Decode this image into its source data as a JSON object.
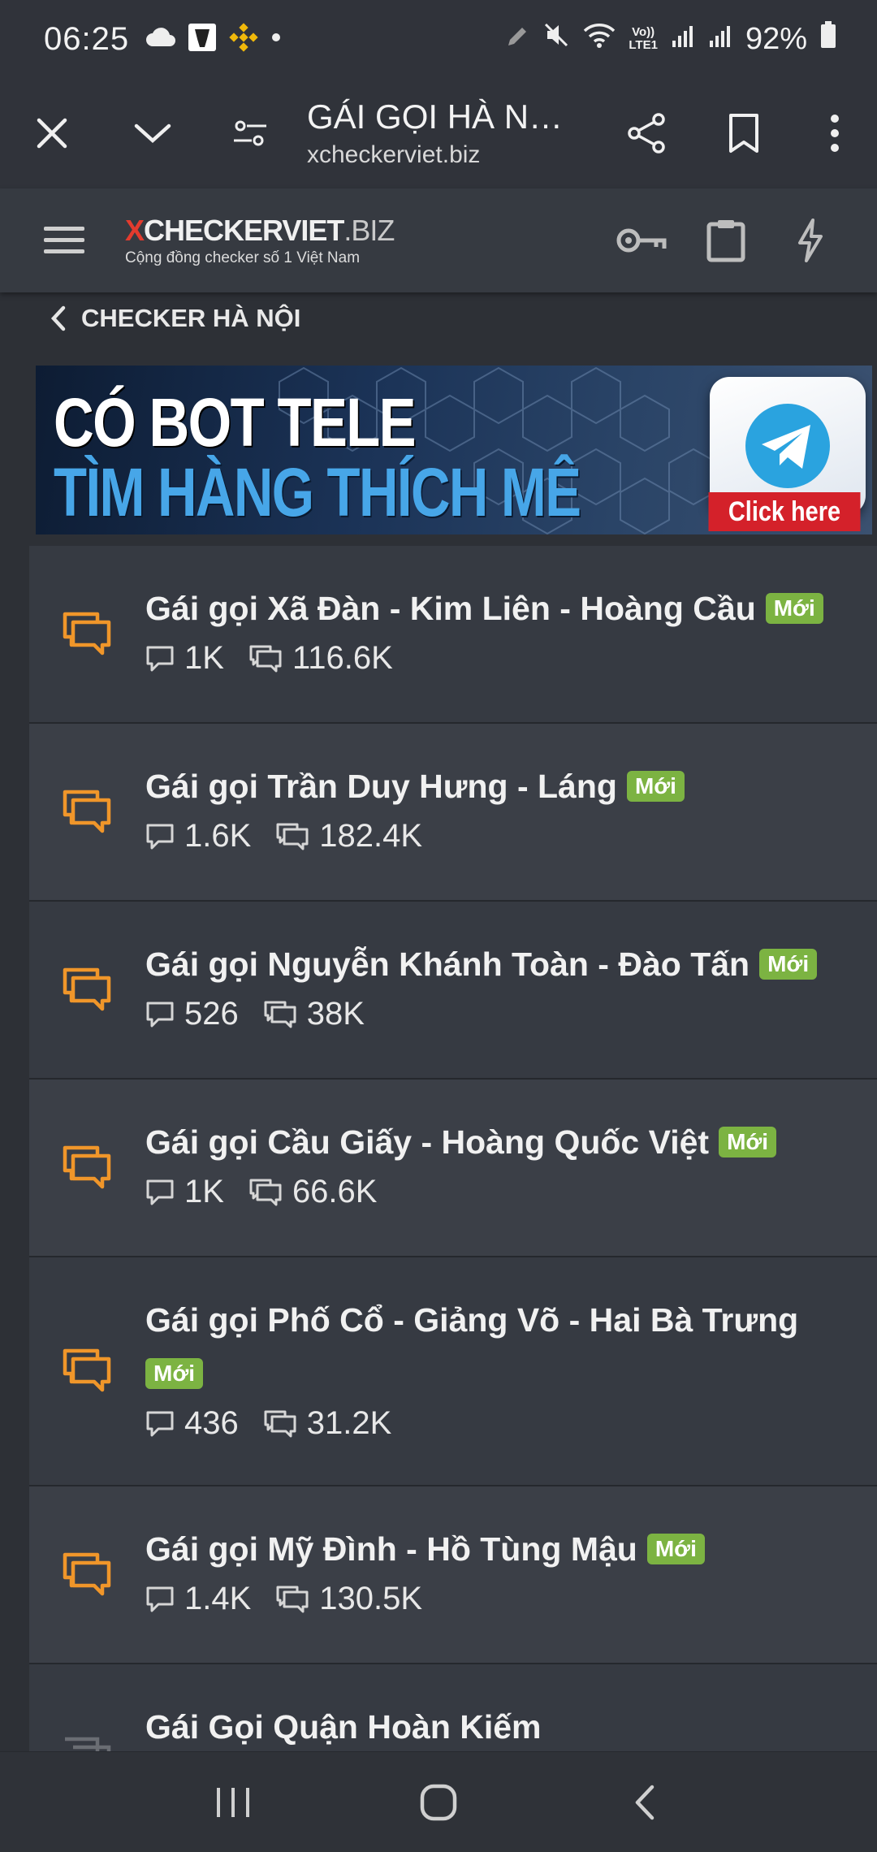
{
  "status_bar": {
    "time": "06:25",
    "battery": "92%",
    "network": "LTE1",
    "volte": "Vo))"
  },
  "browser": {
    "title": "GÁI GỌI HÀ NỘI |...",
    "url": "xcheckerviet.biz"
  },
  "site": {
    "logo_x": "X",
    "logo_main": "CHECKERVIET",
    "logo_tld": ".BIZ",
    "tagline": "Cộng đồng checker số 1 Việt Nam"
  },
  "breadcrumb": {
    "label": "CHECKER HÀ NỘI"
  },
  "banner": {
    "line1": "CÓ BOT TELE",
    "line2": "TÌM HÀNG THÍCH MÊ",
    "cta": "Click here"
  },
  "threads": [
    {
      "title": "Gái gọi Xã Đàn - Kim Liên - Hoàng Cầu",
      "badge": "Mới",
      "replies": "1K",
      "views": "116.6K"
    },
    {
      "title": "Gái gọi Trần Duy Hưng - Láng",
      "badge": "Mới",
      "replies": "1.6K",
      "views": "182.4K"
    },
    {
      "title": "Gái gọi Nguyễn Khánh Toàn - Đào Tấn",
      "badge": "Mới",
      "replies": "526",
      "views": "38K"
    },
    {
      "title": "Gái gọi Cầu Giấy - Hoàng Quốc Việt",
      "badge": "Mới",
      "replies": "1K",
      "views": "66.6K"
    },
    {
      "title": "Gái gọi Phố Cổ - Giảng Võ - Hai Bà Trưng",
      "badge": "Mới",
      "replies": "436",
      "views": "31.2K"
    },
    {
      "title": "Gái gọi Mỹ Đình - Hồ Tùng Mậu",
      "badge": "Mới",
      "replies": "1.4K",
      "views": "130.5K"
    },
    {
      "title": "Gái Gọi Quận Hoàn Kiếm"
    }
  ],
  "colors": {
    "accent_orange": "#f0962a",
    "badge_green": "#7cb342",
    "logo_red": "#e33b2e"
  }
}
